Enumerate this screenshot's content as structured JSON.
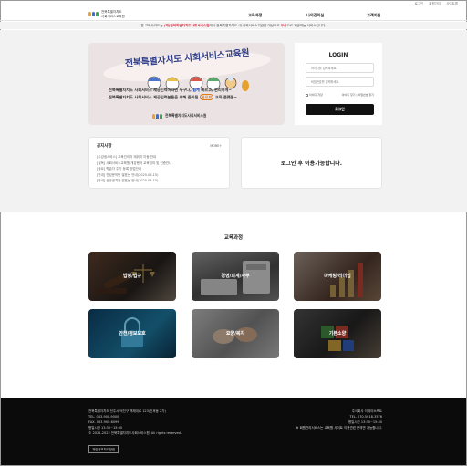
{
  "util_links": [
    "로그인",
    "회원가입",
    "사이트맵"
  ],
  "header": {
    "logo_line1": "전북특별자치도",
    "logo_line2": "사회서비스교육원",
    "nav": [
      "교육과정",
      "나의강의실",
      "고객지원"
    ]
  },
  "notice_bar": {
    "prefix": "본 교육사이트는",
    "highlight": "(재)전북특별자치도사회서비스원",
    "middle": "에서 전북특별자치도 내 사회서비스기관을 대상으로",
    "free": "무상",
    "suffix": "으로 제공하는 서비스입니다."
  },
  "banner": {
    "title": "전북특별자치도 사회서비스교육원",
    "line1": "전북특별자치도 사회서비스 제공인력이라면 누구나,",
    "line1_hl": "쉽게",
    "line1_b": "빠르고, 편리하게~",
    "line2": "전북특별자치도 사회서비스 제공인력분들을 위해 준비된",
    "line2_hl": "온오프",
    "line2_b": "교육 플랫폼~",
    "org_name": "전북특별자치도사회서비스원"
  },
  "login": {
    "title": "LOGIN",
    "id_placeholder": "아이디를 입력하세요.",
    "pw_placeholder": "비밀번호를 입력하세요.",
    "save_id": "아이디 저장",
    "find_id": "아이디 찾기",
    "find_pw": "비밀번호 찾기",
    "button": "로그인"
  },
  "news": {
    "title": "공지사항",
    "more": "MORE+",
    "items": [
      "[수강생서비스] 교육관리자 재위치 이동 안내",
      "[필독] 사회서비스교육원 개강했어 교육참여 및 인증안내",
      "[중요] 학습자 주기 등록 방법안내",
      "[안내] 진성문의번 발표는 안내(2025.05.15)",
      "[안내] 신규공지된 발표는 안내(2025.04.15)"
    ]
  },
  "login_message": "로그인 후 이용가능합니다.",
  "courses": {
    "title": "교육과정",
    "items": [
      "법령/법규",
      "경영/회계/사무",
      "마케팅/리더십",
      "안전/정보보호",
      "요양/복지",
      "기본소양"
    ]
  },
  "footer": {
    "address": "전북특별자치도 전주시 덕진구 백제대로 123(인후동 2가)",
    "tel": "TEL. 063-900-9000",
    "fax": "FAX. 063-900-6099",
    "hours": "평일시간 13:30~15:30",
    "copyright": "© 2021-2022 전북특별자치도사회서비스원. All rights reserved.",
    "privacy_button": "개인정보처리방침",
    "right1": "주식회사 이데아소프트",
    "right2": "TEL. 070-5018-3576",
    "right3": "평일시간 13:30~15:30",
    "warning": "※ 회원관리서비스는 교육원 사이트 이용관련 문의만 가능합니다."
  },
  "colors": {
    "accent": "#2f3d8a",
    "highlight_red": "#d8334a",
    "footer_bg": "#0b0b0b"
  }
}
